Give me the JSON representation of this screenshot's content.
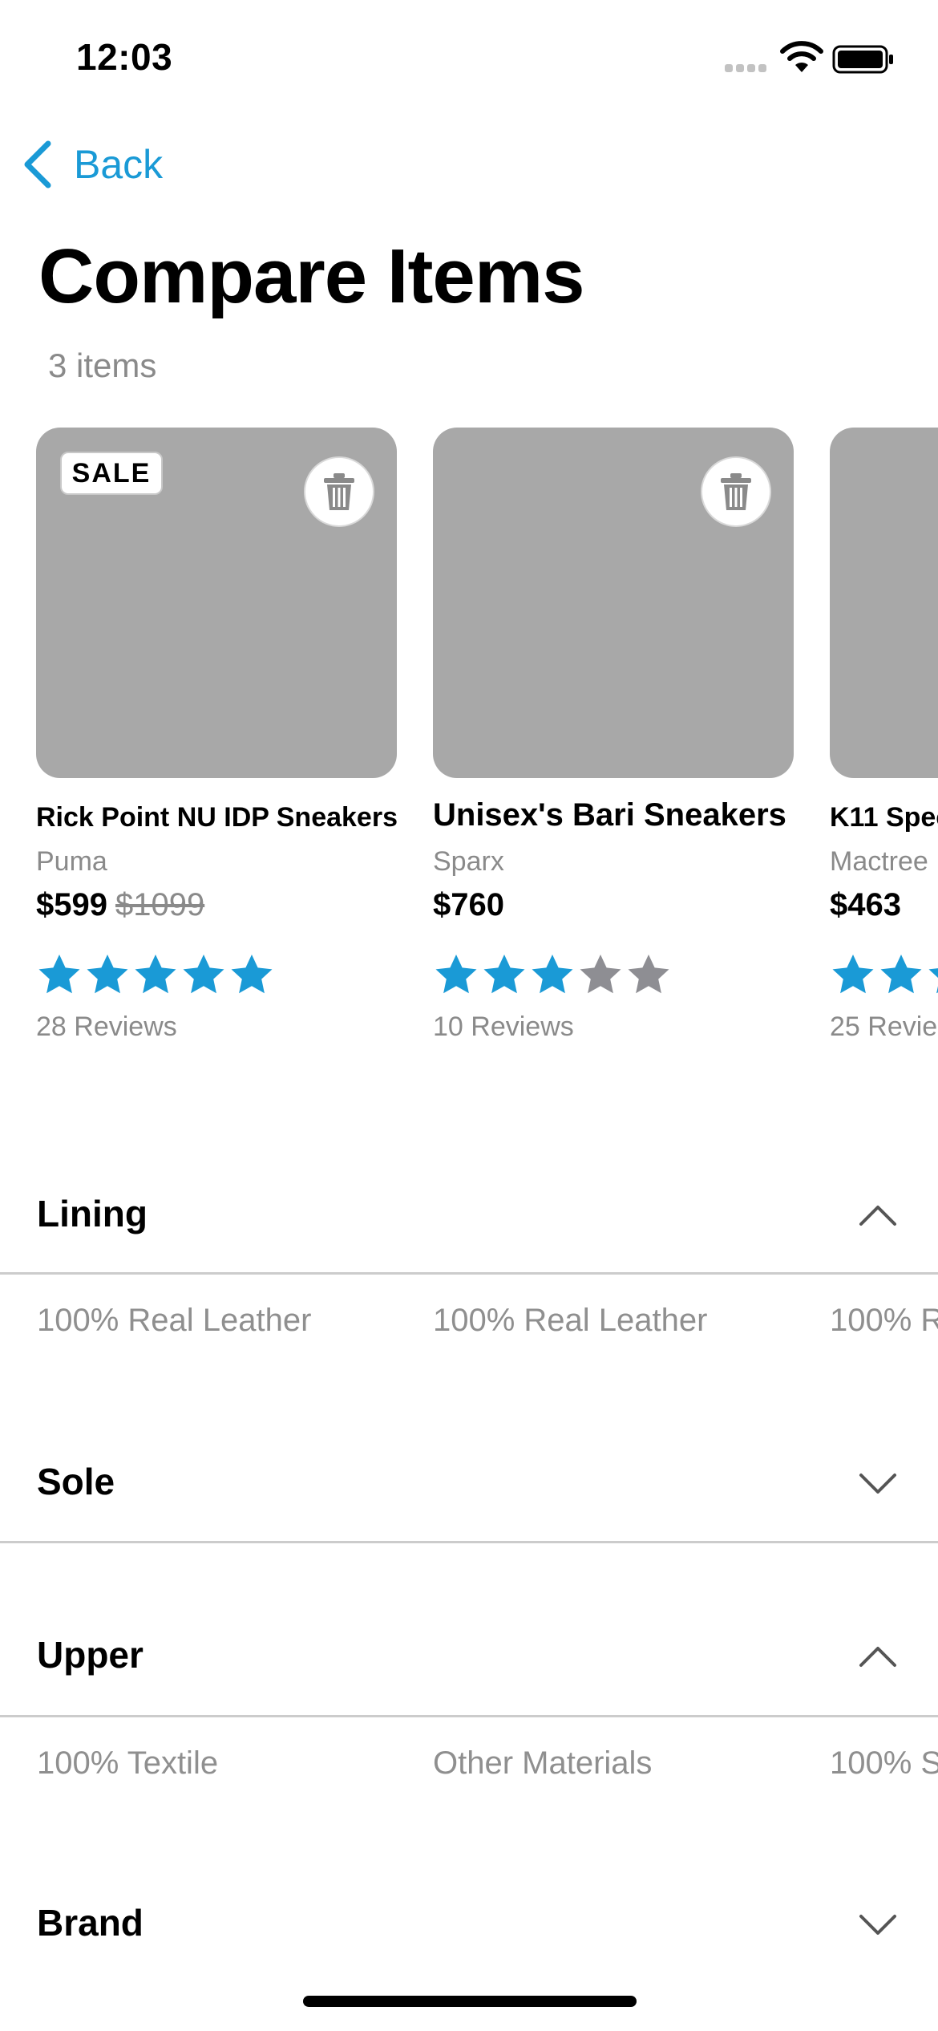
{
  "status_bar": {
    "time": "12:03"
  },
  "nav": {
    "back_label": "Back"
  },
  "page": {
    "title": "Compare Items",
    "count": "3 items"
  },
  "colors": {
    "accent": "#1a9ad6",
    "star_filled": "#1a9ad6",
    "star_empty": "#8e8e93",
    "placeholder": "#a8a8a8"
  },
  "products": [
    {
      "badge": "SALE",
      "name": "Rick Point NU IDP Sneakers",
      "brand": "Puma",
      "price": "$599",
      "old_price": "$1099",
      "rating": 5,
      "reviews": "28 Reviews"
    },
    {
      "badge": "",
      "name": "Unisex's Bari Sneakers",
      "brand": "Sparx",
      "price": "$760",
      "old_price": "",
      "rating": 3,
      "reviews": "10 Reviews"
    },
    {
      "badge": "",
      "name": "K11 Spec",
      "brand": "Mactree",
      "price": "$463",
      "old_price": "",
      "rating": 3,
      "reviews": "25 Revie"
    }
  ],
  "sections": [
    {
      "title": "Lining",
      "expanded": true,
      "values": [
        "100% Real Leather",
        "100% Real Leather",
        "100% R"
      ]
    },
    {
      "title": "Sole",
      "expanded": false,
      "values": []
    },
    {
      "title": "Upper",
      "expanded": true,
      "values": [
        "100% Textile",
        "Other Materials",
        "100% S"
      ]
    },
    {
      "title": "Brand",
      "expanded": false,
      "values": []
    }
  ]
}
